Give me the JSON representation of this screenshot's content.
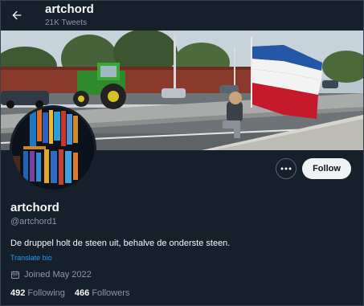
{
  "header": {
    "name": "artchord",
    "tweet_count": "21K Tweets"
  },
  "profile": {
    "name": "artchord",
    "handle": "@artchord1",
    "bio": "De druppel holt de steen uit, behalve de onderste steen.",
    "translate_label": "Translate bio",
    "joined": "Joined May 2022"
  },
  "actions": {
    "follow_label": "Follow"
  },
  "stats": {
    "following_count": "492",
    "following_label": "Following",
    "followers_count": "466",
    "followers_label": "Followers"
  },
  "icons": {
    "back": "arrow-left-icon",
    "more": "more-dots-icon",
    "calendar": "calendar-icon"
  },
  "colors": {
    "background": "#15202b",
    "text_primary": "#f7f9f9",
    "text_secondary": "#8b98a5",
    "link": "#1d9bf0",
    "follow_button_bg": "#eff3f4"
  }
}
